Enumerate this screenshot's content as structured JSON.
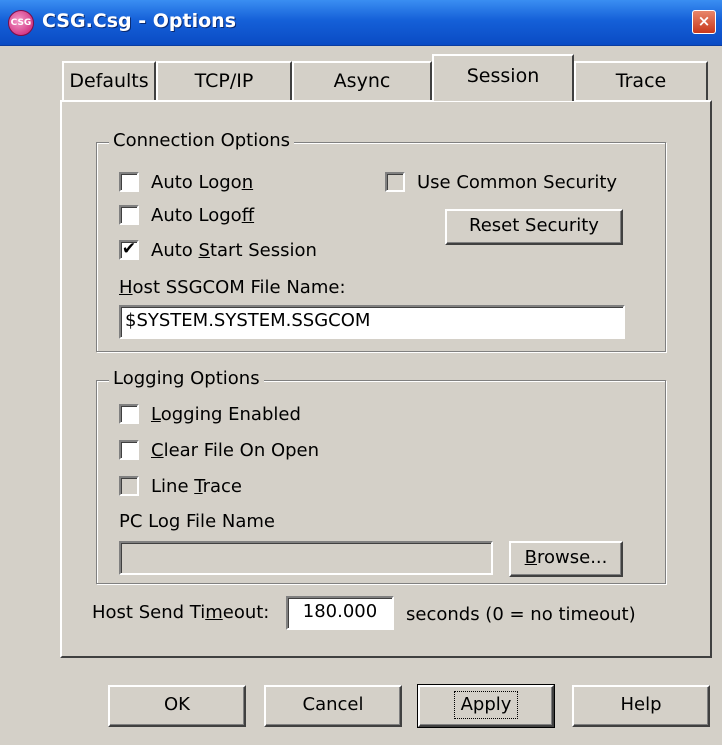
{
  "window": {
    "title": "CSG.Csg - Options",
    "icon": "csg-app-icon",
    "close_glyph": "×"
  },
  "tabs": [
    {
      "label": "Defaults",
      "active": false
    },
    {
      "label": "TCP/IP",
      "active": false
    },
    {
      "label": "Async",
      "active": false
    },
    {
      "label": "Session",
      "active": true
    },
    {
      "label": "Trace",
      "active": false
    }
  ],
  "connection": {
    "legend": "Connection Options",
    "auto_logon": {
      "pre": "Auto Logo",
      "u": "n",
      "post": "",
      "checked": false
    },
    "auto_logoff": {
      "pre": "Auto Logo",
      "u": "f",
      "post": "f",
      "checked": false
    },
    "auto_start": {
      "pre": "Auto ",
      "u": "S",
      "post": "tart Session",
      "checked": true,
      "mark": "✔"
    },
    "use_common_security": {
      "label": "Use Common Security",
      "checked": false
    },
    "reset_security_label": "Reset Security",
    "host_file_label": {
      "pre": "",
      "u": "H",
      "post": "ost SSGCOM File Name:"
    },
    "host_file_value": "$SYSTEM.SYSTEM.SSGCOM"
  },
  "logging": {
    "legend": "Logging Options",
    "logging_enabled": {
      "pre": "",
      "u": "L",
      "post": "ogging Enabled",
      "checked": false
    },
    "clear_file": {
      "pre": "",
      "u": "C",
      "post": "lear File On Open",
      "checked": false
    },
    "line_trace": {
      "pre": "Line ",
      "u": "T",
      "post": "race",
      "checked": false,
      "enabled": false
    },
    "pc_log_label": "PC Log File Name",
    "pc_log_value": "",
    "browse": {
      "pre": "",
      "u": "B",
      "post": "rowse..."
    }
  },
  "timeout": {
    "label_pre": "Host Send Ti",
    "label_u": "m",
    "label_post": "eout:",
    "value": "180.000",
    "suffix": "seconds (0 = no timeout)"
  },
  "buttons": {
    "ok": "OK",
    "cancel": "Cancel",
    "apply": "Apply",
    "help": "Help"
  }
}
